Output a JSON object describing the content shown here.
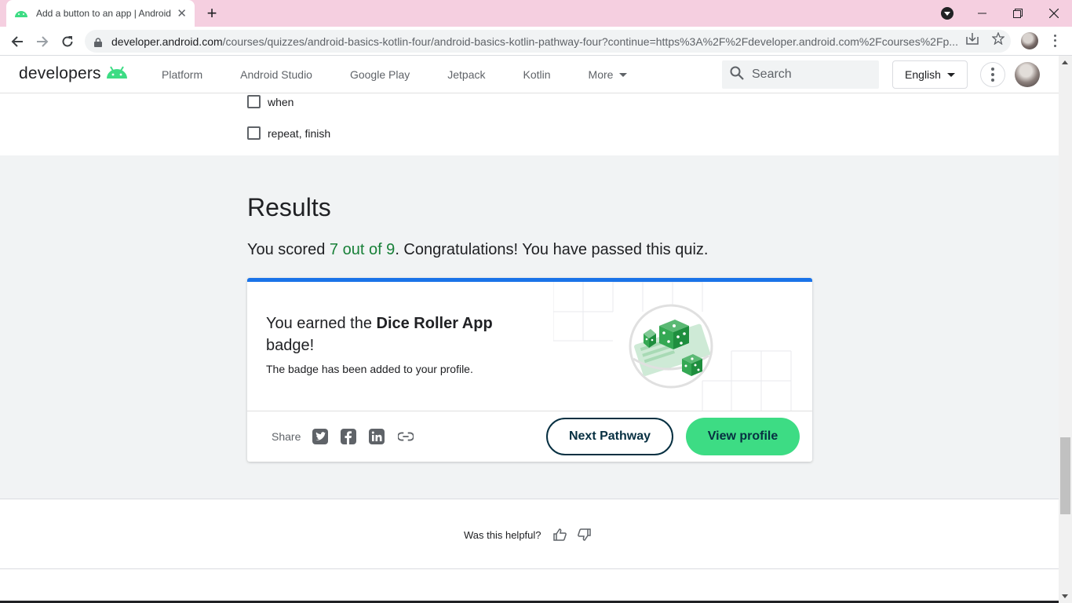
{
  "browser": {
    "tab_title": "Add a button to an app  |  Android Developers",
    "tab_close": "✕",
    "new_tab": "+",
    "url_host": "developer.android.com",
    "url_path": "/courses/quizzes/android-basics-kotlin-four/android-basics-kotlin-pathway-four?continue=https%3A%2F%2Fdeveloper.android.com%2Fcourses%2Fp...",
    "window_controls": [
      "minimize",
      "restore",
      "close"
    ]
  },
  "site": {
    "logo_text": "developers",
    "nav": [
      "Platform",
      "Android Studio",
      "Google Play",
      "Jetpack",
      "Kotlin",
      "More"
    ],
    "search_placeholder": "Search",
    "language": "English"
  },
  "quiz": {
    "options": [
      "when",
      "repeat, finish"
    ]
  },
  "results": {
    "title": "Results",
    "score_prefix": "You scored ",
    "score": "7 out of 9",
    "score_suffix": ". Congratulations! You have passed this quiz.",
    "earned_prefix": "You earned the ",
    "badge_name": "Dice Roller App",
    "earned_suffix": " badge!",
    "badge_sub": "The badge has been added to your profile.",
    "share_label": "Share",
    "share_icons": [
      "twitter-icon",
      "facebook-icon",
      "linkedin-icon",
      "link-icon"
    ],
    "next_button": "Next Pathway",
    "profile_button": "View profile"
  },
  "feedback": {
    "question": "Was this helpful?"
  },
  "colors": {
    "accent_blue": "#1a73e8",
    "android_green": "#3ddc84",
    "score_green": "#188038",
    "dark_teal": "#073042"
  }
}
